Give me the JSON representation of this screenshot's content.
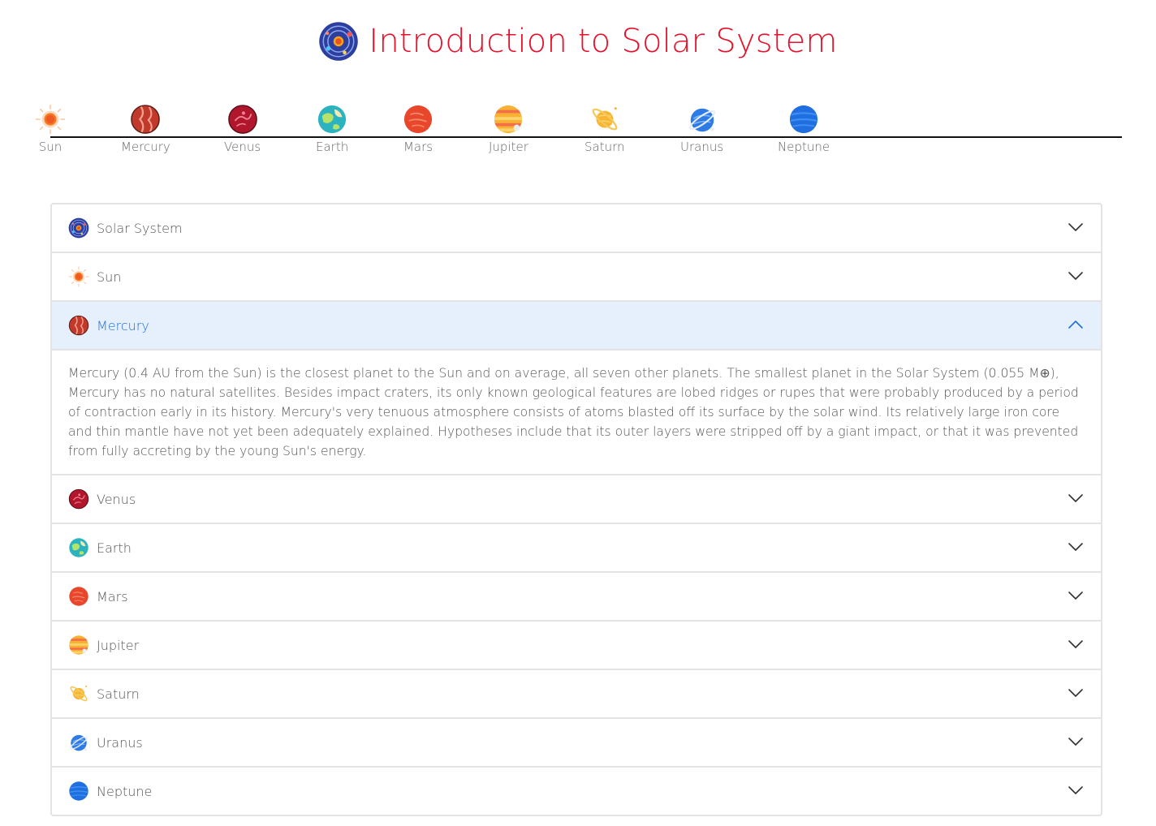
{
  "header": {
    "title": "Introduction to Solar System"
  },
  "timeline": {
    "items": [
      {
        "label": "Sun",
        "icon": "sun-icon"
      },
      {
        "label": "Mercury",
        "icon": "mercury-icon"
      },
      {
        "label": "Venus",
        "icon": "venus-icon"
      },
      {
        "label": "Earth",
        "icon": "earth-icon"
      },
      {
        "label": "Mars",
        "icon": "mars-icon"
      },
      {
        "label": "Jupiter",
        "icon": "jupiter-icon"
      },
      {
        "label": "Saturn",
        "icon": "saturn-icon"
      },
      {
        "label": "Uranus",
        "icon": "uranus-icon"
      },
      {
        "label": "Neptune",
        "icon": "neptune-icon"
      }
    ]
  },
  "accordion": {
    "items": [
      {
        "label": "Solar System",
        "icon": "solar-system-icon",
        "expanded": false
      },
      {
        "label": "Sun",
        "icon": "sun-icon",
        "expanded": false
      },
      {
        "label": "Mercury",
        "icon": "mercury-icon",
        "expanded": true,
        "content": "Mercury (0.4 AU from the Sun) is the closest planet to the Sun and on average, all seven other planets. The smallest planet in the Solar System (0.055 M⊕), Mercury has no natural satellites. Besides impact craters, its only known geological features are lobed ridges or rupes that were probably produced by a period of contraction early in its history. Mercury's very tenuous atmosphere consists of atoms blasted off its surface by the solar wind. Its relatively large iron core and thin mantle have not yet been adequately explained. Hypotheses include that its outer layers were stripped off by a giant impact, or that it was prevented from fully accreting by the young Sun's energy."
      },
      {
        "label": "Venus",
        "icon": "venus-icon",
        "expanded": false
      },
      {
        "label": "Earth",
        "icon": "earth-icon",
        "expanded": false
      },
      {
        "label": "Mars",
        "icon": "mars-icon",
        "expanded": false
      },
      {
        "label": "Jupiter",
        "icon": "jupiter-icon",
        "expanded": false
      },
      {
        "label": "Saturn",
        "icon": "saturn-icon",
        "expanded": false
      },
      {
        "label": "Uranus",
        "icon": "uranus-icon",
        "expanded": false
      },
      {
        "label": "Neptune",
        "icon": "neptune-icon",
        "expanded": false
      }
    ]
  },
  "colors": {
    "title": "#e8102a",
    "accent": "#1e6fd6",
    "active_bg": "#e6f0fd",
    "border": "#e3e3e3"
  }
}
